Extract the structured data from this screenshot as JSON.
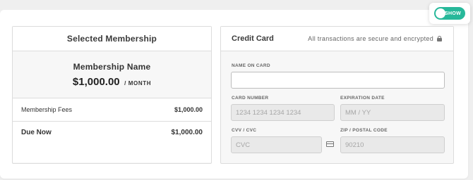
{
  "toggle": {
    "label": "SHOW",
    "on": true,
    "color": "#27b89a"
  },
  "membership": {
    "header": "Selected Membership",
    "name": "Membership Name",
    "price": "$1,000.00",
    "period": "/ MONTH",
    "rows": [
      {
        "label": "Membership Fees",
        "value": "$1,000.00"
      },
      {
        "label": "Due Now",
        "value": "$1,000.00"
      }
    ]
  },
  "credit_card": {
    "title": "Credit Card",
    "secure_note": "All transactions are secure and encrypted",
    "fields": {
      "name": {
        "label": "NAME ON CARD",
        "value": "",
        "placeholder": ""
      },
      "number": {
        "label": "CARD NUMBER",
        "placeholder": "1234 1234 1234 1234"
      },
      "expiry": {
        "label": "EXPIRATION DATE",
        "placeholder": "MM / YY"
      },
      "cvv": {
        "label": "CVV / CVC",
        "placeholder": "CVC"
      },
      "zip": {
        "label": "ZIP / POSTAL CODE",
        "placeholder": "90210"
      }
    }
  }
}
